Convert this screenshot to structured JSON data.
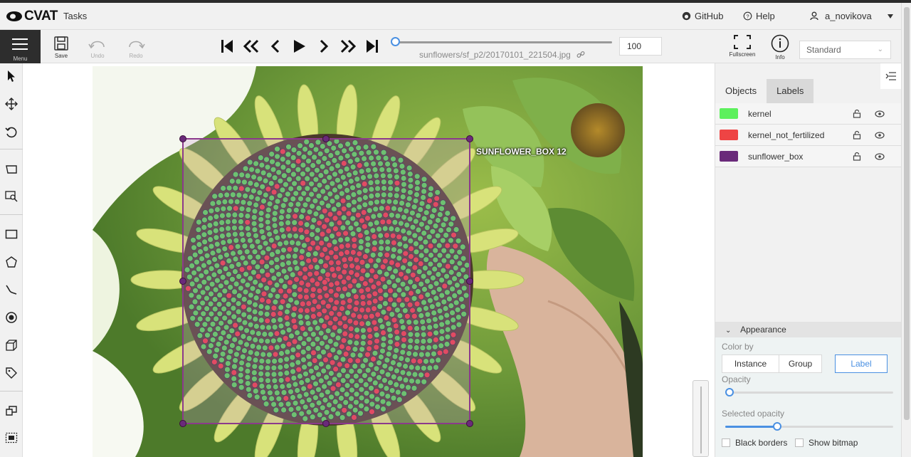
{
  "header": {
    "logo_text": "CVAT",
    "tasks_label": "Tasks",
    "github_label": "GitHub",
    "help_label": "Help",
    "user_name": "a_novikova"
  },
  "toolbar": {
    "menu_label": "Menu",
    "save_label": "Save",
    "undo_label": "Undo",
    "redo_label": "Redo",
    "filename": "sunflowers/sf_p2/20170101_221504.jpg",
    "frame_number": "100",
    "frame_progress": 0,
    "fullscreen_label": "Fullscreen",
    "info_label": "Info",
    "workspace_value": "Standard"
  },
  "canvas": {
    "box_label": "SUNFLOWER_BOX 12",
    "box_color": "#8b3a8b"
  },
  "sidebar": {
    "tabs": [
      {
        "label": "Objects"
      },
      {
        "label": "Labels"
      }
    ],
    "active_tab": "Labels",
    "labels": [
      {
        "name": "kernel",
        "color": "#5cf05c"
      },
      {
        "name": "kernel_not_fertilized",
        "color": "#ee4444"
      },
      {
        "name": "sunflower_box",
        "color": "#6a2a7a"
      }
    ],
    "appearance": {
      "title": "Appearance",
      "color_by_label": "Color by",
      "color_by_options": [
        "Instance",
        "Group",
        "Label"
      ],
      "color_by_selected": "Label",
      "opacity_label": "Opacity",
      "opacity_value": 0,
      "selected_opacity_label": "Selected opacity",
      "selected_opacity_value": 0.3,
      "black_borders_label": "Black borders",
      "show_bitmap_label": "Show bitmap"
    }
  },
  "colors": {
    "accent": "#4a90e2",
    "menu_bg": "#2d2d2d"
  }
}
